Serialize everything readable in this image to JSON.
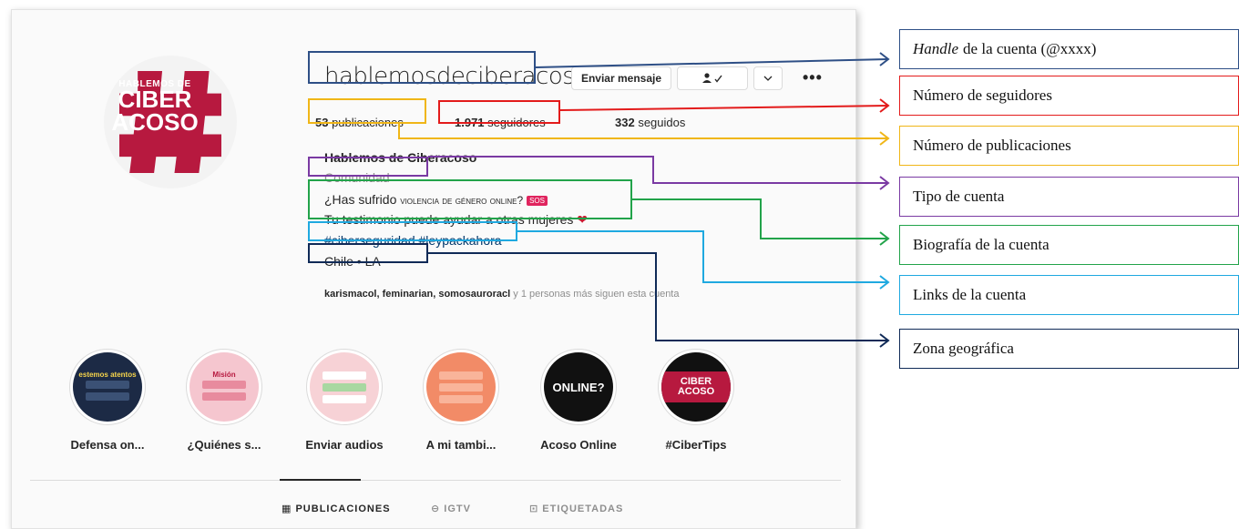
{
  "profile": {
    "handle": "hablemosdeciberacoso",
    "message_button": "Enviar mensaje",
    "name": "Hablemos de Ciberacoso",
    "category": "Comunidad",
    "bio_line1_a": "¿Has sufrido ",
    "bio_line1_b": "violencia de género online?",
    "bio_sos": "SOS",
    "bio_line2": "Tu testimonio puede ayudar a otras mujeres",
    "tags": "#ciberseguridad #leypackahora",
    "location": "Chile • LA",
    "followed_by_names": "karismacol, feminarian, somosauroracl",
    "followed_by_rest": " y 1 personas más siguen esta cuenta",
    "logo": {
      "line1": "HABLEMOS DE",
      "line2": "CIBER",
      "line3": "ACOSO"
    }
  },
  "stats": {
    "posts_count": "53",
    "posts_label": " publicaciones",
    "followers_count": "1.971",
    "followers_label": " seguidores",
    "following_count": "332",
    "following_label": " seguidos"
  },
  "highlights": [
    {
      "label": "Defensa on...",
      "cover": "estemos atentos"
    },
    {
      "label": "¿Quiénes s...",
      "cover": "Misión"
    },
    {
      "label": "Enviar audios",
      "cover": ""
    },
    {
      "label": "A mi tambi...",
      "cover": ""
    },
    {
      "label": "Acoso Online",
      "cover": "ONLINE?"
    },
    {
      "label": "#CiberTips",
      "cover": "CIBER ACOSO"
    }
  ],
  "tabs": [
    {
      "label": "PUBLICACIONES",
      "icon": "grid-icon"
    },
    {
      "label": "IGTV",
      "icon": "igtv-icon"
    },
    {
      "label": "ETIQUETADAS",
      "icon": "tag-icon"
    }
  ],
  "callouts": {
    "handle_em": "Handle",
    "handle_rest": "de la cuenta (@xxxx)",
    "followers": "Número de seguidores",
    "posts": "Número de publicaciones",
    "account_type": "Tipo de cuenta",
    "bio": "Biografía de la cuenta",
    "links": "Links de la cuenta",
    "zone": "Zona geográfica"
  },
  "colors": {
    "handle": "#2e4f86",
    "followers": "#e31b1b",
    "posts": "#f0b617",
    "type": "#7a3aa3",
    "bio": "#22a34a",
    "links": "#1fa9e0",
    "zone": "#0f2a57"
  }
}
